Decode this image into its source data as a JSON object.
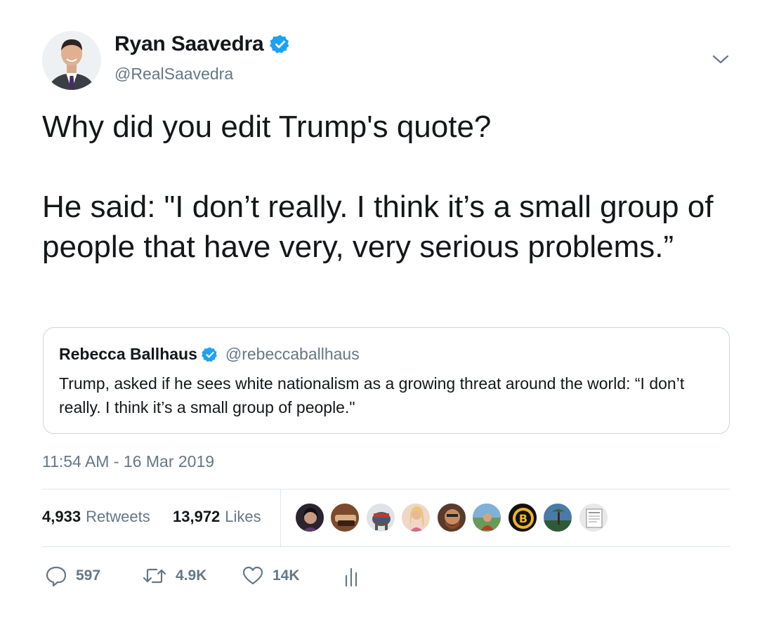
{
  "author": {
    "name": "Ryan Saavedra",
    "handle": "@RealSaavedra"
  },
  "tweet": {
    "line1": "Why did you edit Trump's quote?",
    "line2": "He said: \"I don’t really. I think it’s a small group of people that have very, very serious problems.”"
  },
  "quoted_tweet": {
    "name": "Rebecca Ballhaus",
    "handle": "@rebeccaballhaus",
    "text": "Trump, asked if he sees white nationalism as a growing threat around the world: “I don’t really. I think it’s a small group of people.\""
  },
  "timestamp": "11:54 AM - 16 Mar 2019",
  "stats": {
    "retweets_count": "4,933",
    "retweets_label": "Retweets",
    "likes_count": "13,972",
    "likes_label": "Likes"
  },
  "liker_avatars": [
    "liker-avatar-1",
    "liker-avatar-2",
    "liker-avatar-3",
    "liker-avatar-4",
    "liker-avatar-5",
    "liker-avatar-6",
    "liker-avatar-7",
    "liker-avatar-8",
    "liker-avatar-9"
  ],
  "actions": {
    "reply_count": "597",
    "retweet_count": "4.9K",
    "like_count": "14K"
  },
  "colors": {
    "text": "#14171a",
    "secondary": "#657786",
    "border": "#ccd6dd",
    "divider": "#e1e8ed",
    "verified": "#1da1f2"
  },
  "icons": [
    "verified-badge-icon",
    "chevron-down-icon",
    "reply-icon",
    "retweet-icon",
    "heart-icon",
    "analytics-icon"
  ]
}
